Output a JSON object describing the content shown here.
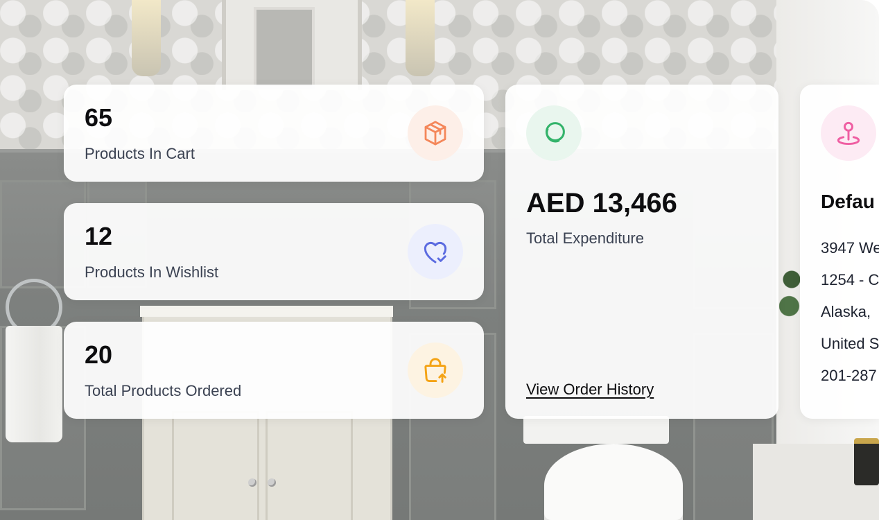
{
  "stats": {
    "cart": {
      "value": "65",
      "label": "Products In Cart",
      "icon": "package-icon",
      "icon_color": "#f4875a",
      "icon_bg": "#fdefe8"
    },
    "wishlist": {
      "value": "12",
      "label": "Products In Wishlist",
      "icon": "heart-check-icon",
      "icon_color": "#5b6be0",
      "icon_bg": "#eceffd"
    },
    "ordered": {
      "value": "20",
      "label": "Total Products Ordered",
      "icon": "shopping-bag-upload-icon",
      "icon_color": "#f4a315",
      "icon_bg": "#fdf3e2"
    }
  },
  "expenditure": {
    "amount": "AED 13,466",
    "label": "Total Expenditure",
    "link_label": "View Order History",
    "icon": "coins-icon",
    "icon_color": "#33b36a"
  },
  "address": {
    "title": "Defau",
    "lines": [
      "3947 We",
      "1254 - C",
      "Alaska,",
      "United S",
      "201-287"
    ],
    "icon": "map-pin-icon",
    "icon_color": "#ef5ea2"
  }
}
